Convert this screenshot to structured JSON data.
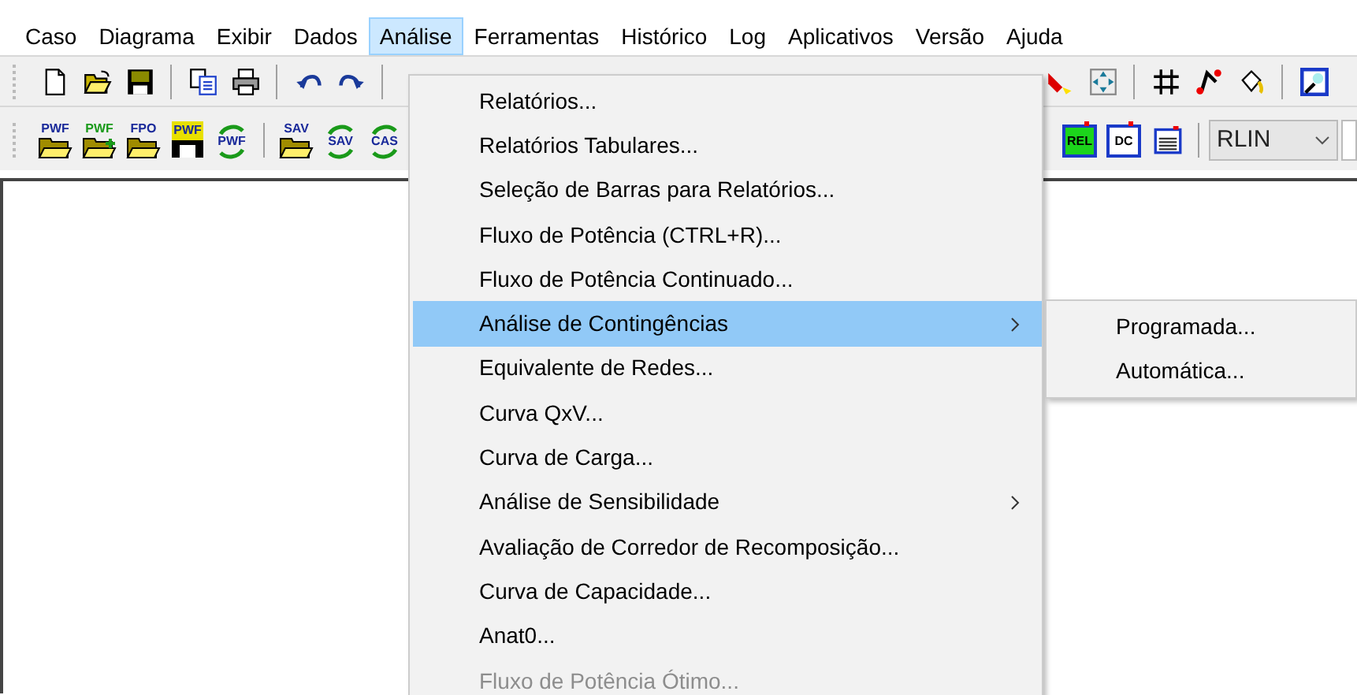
{
  "menu_bar": [
    {
      "label": "Caso",
      "selected": false
    },
    {
      "label": "Diagrama",
      "selected": false
    },
    {
      "label": "Exibir",
      "selected": false
    },
    {
      "label": "Dados",
      "selected": false
    },
    {
      "label": "Análise",
      "selected": true
    },
    {
      "label": "Ferramentas",
      "selected": false
    },
    {
      "label": "Histórico",
      "selected": false
    },
    {
      "label": "Log",
      "selected": false
    },
    {
      "label": "Aplicativos",
      "selected": false
    },
    {
      "label": "Versão",
      "selected": false
    },
    {
      "label": "Ajuda",
      "selected": false
    }
  ],
  "toolbar_1": {
    "left": [
      {
        "kind": "new"
      },
      {
        "kind": "open"
      },
      {
        "kind": "save"
      },
      {
        "kind": "separator"
      },
      {
        "kind": "copy"
      },
      {
        "kind": "print"
      },
      {
        "kind": "separator"
      },
      {
        "kind": "undo"
      },
      {
        "kind": "redo"
      },
      {
        "kind": "separator"
      }
    ],
    "right": [
      {
        "kind": "lamp"
      },
      {
        "kind": "move"
      },
      {
        "kind": "separator"
      },
      {
        "kind": "grid"
      },
      {
        "kind": "node"
      },
      {
        "kind": "bucket"
      },
      {
        "kind": "separator"
      },
      {
        "kind": "picture"
      }
    ]
  },
  "toolbar_2": {
    "left": [
      {
        "kind": "open-file",
        "label": "PWF"
      },
      {
        "kind": "add-file",
        "label": "PWF"
      },
      {
        "kind": "open-file",
        "label": "FPO"
      },
      {
        "kind": "save-file",
        "label": "PWF"
      },
      {
        "kind": "refresh-file",
        "label": "PWF"
      },
      {
        "kind": "separator"
      },
      {
        "kind": "open-file",
        "label": "SAV"
      },
      {
        "kind": "refresh-file",
        "label": "SAV"
      },
      {
        "kind": "refresh-file",
        "label": "CAS"
      }
    ],
    "right": [
      {
        "kind": "window",
        "label": "REL"
      },
      {
        "kind": "window",
        "label": "DC"
      },
      {
        "kind": "list"
      },
      {
        "kind": "separator"
      },
      {
        "kind": "select",
        "value": "RLIN"
      }
    ]
  },
  "dropdown": [
    {
      "label": "Relatórios...",
      "disabled": false,
      "submenu": false,
      "selected": false
    },
    {
      "label": "Relatórios Tabulares...",
      "disabled": false,
      "submenu": false,
      "selected": false
    },
    {
      "label": "Seleção de Barras para Relatórios...",
      "disabled": false,
      "submenu": false,
      "selected": false
    },
    {
      "label": "Fluxo de Potência (CTRL+R)...",
      "disabled": false,
      "submenu": false,
      "selected": false
    },
    {
      "label": "Fluxo de Potência Continuado...",
      "disabled": false,
      "submenu": false,
      "selected": false
    },
    {
      "label": "Análise de Contingências",
      "disabled": false,
      "submenu": true,
      "selected": true
    },
    {
      "label": "Equivalente de Redes...",
      "disabled": false,
      "submenu": false,
      "selected": false
    },
    {
      "label": "Curva QxV...",
      "disabled": false,
      "submenu": false,
      "selected": false
    },
    {
      "label": "Curva de Carga...",
      "disabled": false,
      "submenu": false,
      "selected": false
    },
    {
      "label": "Análise de Sensibilidade",
      "disabled": false,
      "submenu": true,
      "selected": false
    },
    {
      "label": "Avaliação de Corredor de Recomposição...",
      "disabled": false,
      "submenu": false,
      "selected": false
    },
    {
      "label": "Curva de Capacidade...",
      "disabled": false,
      "submenu": false,
      "selected": false
    },
    {
      "label": "Anat0...",
      "disabled": false,
      "submenu": false,
      "selected": false
    },
    {
      "label": "Fluxo de Potência Ótimo...",
      "disabled": true,
      "submenu": false,
      "selected": false
    }
  ],
  "submenu": [
    {
      "label": "Programada...",
      "selected": false
    },
    {
      "label": "Automática...",
      "selected": false
    }
  ]
}
